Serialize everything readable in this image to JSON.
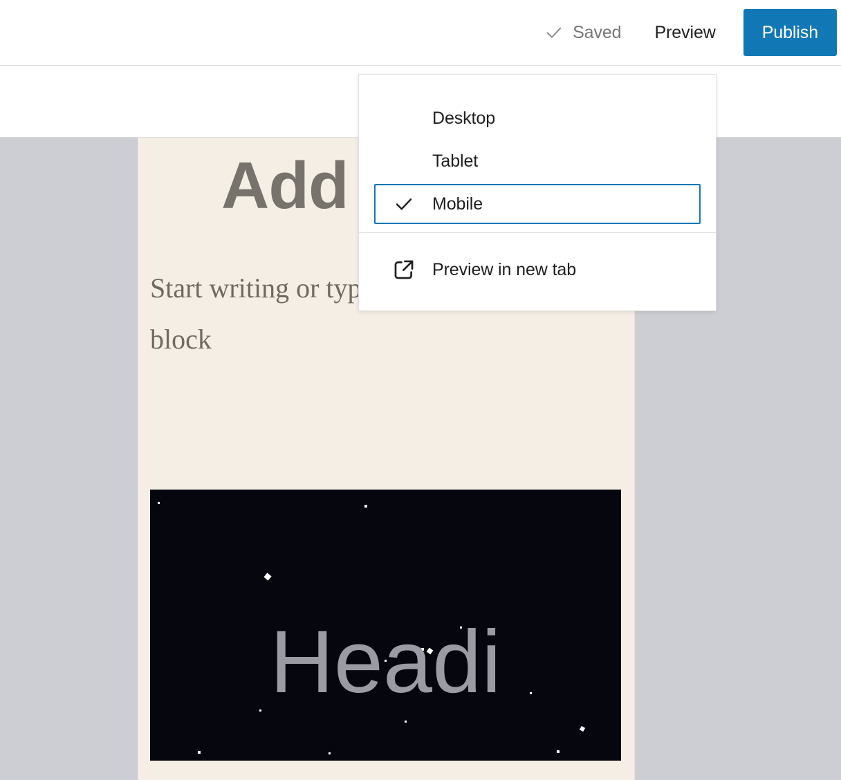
{
  "header": {
    "save_status": {
      "icon": "check-icon",
      "label": "Saved"
    },
    "preview_button": "Preview",
    "publish_button": "Publish",
    "accent_color": "#1278b5"
  },
  "preview_dropdown": {
    "device_options": [
      {
        "label": "Desktop",
        "selected": false
      },
      {
        "label": "Tablet",
        "selected": false
      },
      {
        "label": "Mobile",
        "selected": true
      }
    ],
    "selected_device": "Mobile",
    "actions": [
      {
        "label": "Preview in new tab",
        "icon": "external-link-icon"
      }
    ],
    "selected_border_color": "#1278b5"
  },
  "editor": {
    "canvas_background": "#cdced3",
    "page_background": "#f5eee4",
    "post_title": "Add",
    "paragraph_placeholder": "Start writing or type / to choose a block",
    "cover_block": {
      "heading": "Headi",
      "background_color": "#06060f",
      "heading_color": "#9b9ba3"
    }
  }
}
